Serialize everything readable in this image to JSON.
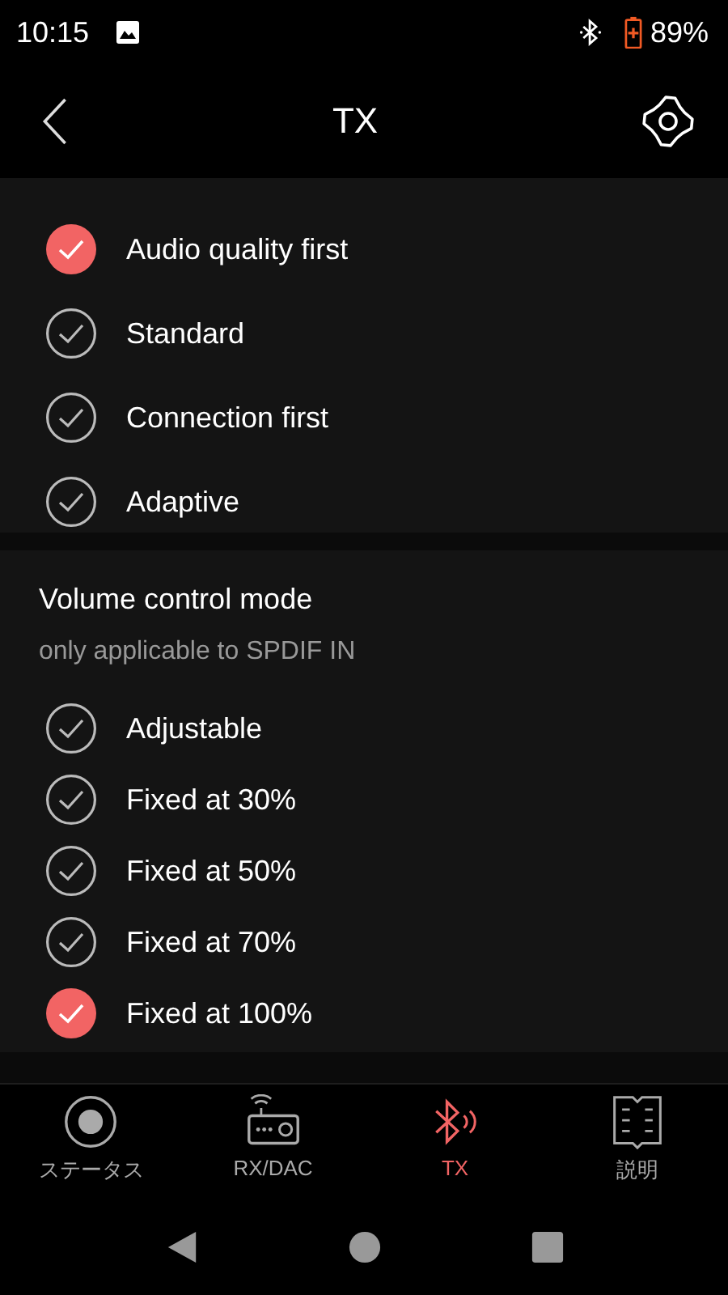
{
  "status_bar": {
    "time": "10:15",
    "battery": "89%"
  },
  "app_bar": {
    "title": "TX"
  },
  "sections": [
    {
      "options": [
        {
          "label": "Audio quality first",
          "selected": true
        },
        {
          "label": "Standard",
          "selected": false
        },
        {
          "label": "Connection first",
          "selected": false
        },
        {
          "label": "Adaptive",
          "selected": false
        }
      ]
    },
    {
      "title": "Volume control mode",
      "subtitle": "only applicable to SPDIF IN",
      "options": [
        {
          "label": "Adjustable",
          "selected": false
        },
        {
          "label": "Fixed at 30%",
          "selected": false
        },
        {
          "label": "Fixed at 50%",
          "selected": false
        },
        {
          "label": "Fixed at 70%",
          "selected": false
        },
        {
          "label": "Fixed at 100%",
          "selected": true
        }
      ]
    }
  ],
  "bottom_nav": [
    {
      "kind": "status",
      "label": "ステータス",
      "selected": false
    },
    {
      "kind": "rxdac",
      "label": "RX/DAC",
      "selected": false
    },
    {
      "kind": "tx",
      "label": "TX",
      "selected": true
    },
    {
      "kind": "manual",
      "label": "説明",
      "selected": false
    }
  ]
}
